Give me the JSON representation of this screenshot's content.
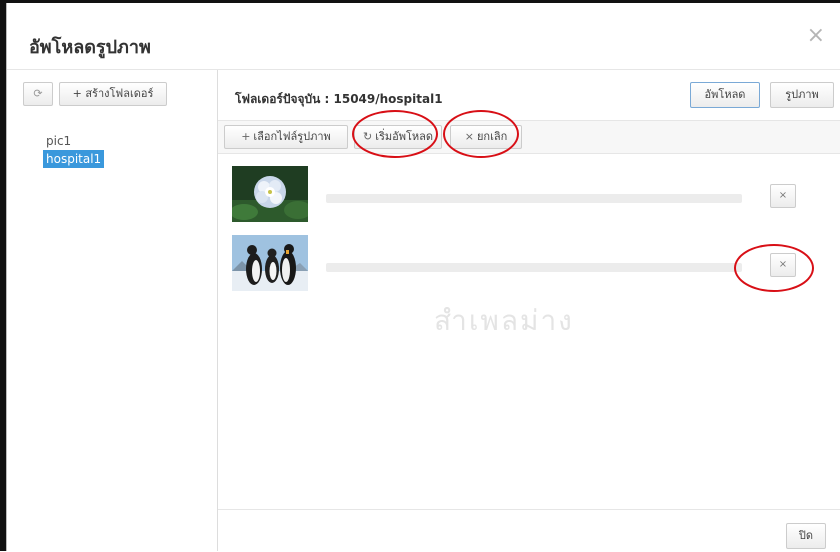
{
  "dialog": {
    "title": "อัพโหลดรูปภาพ",
    "close_symbol": "×"
  },
  "sidebar": {
    "refresh_icon": "⟳",
    "new_folder_label": "+ สร้างโฟลเดอร์",
    "folders": [
      {
        "label": "pic1",
        "selected": false
      },
      {
        "label": "hospital1",
        "selected": true
      }
    ]
  },
  "main": {
    "current_folder_text": "โฟลเดอร์ปัจจุบัน : 15049/hospital1",
    "tabs": {
      "upload_label": "อัพโหลด",
      "images_label": "รูปภาพ"
    },
    "toolbar": {
      "select_files_label": "เลือกไฟล์รูปภาพ",
      "select_files_icon": "+",
      "start_upload_label": "เริ่มอัพโหลด",
      "start_upload_icon": "↻",
      "cancel_label": "ยกเลิก",
      "cancel_icon": "×"
    },
    "files": [
      {
        "thumbnail": "flower",
        "progress": 0,
        "remove_icon": "×"
      },
      {
        "thumbnail": "penguins",
        "progress": 0,
        "remove_icon": "×"
      }
    ],
    "watermark_text": "สำเพลม่าง",
    "footer": {
      "close_label": "ปิด"
    }
  },
  "colors": {
    "selected_folder": "#3a98dc",
    "annotation_circle": "#d80f16",
    "active_tab_border": "#7aa9d6"
  }
}
